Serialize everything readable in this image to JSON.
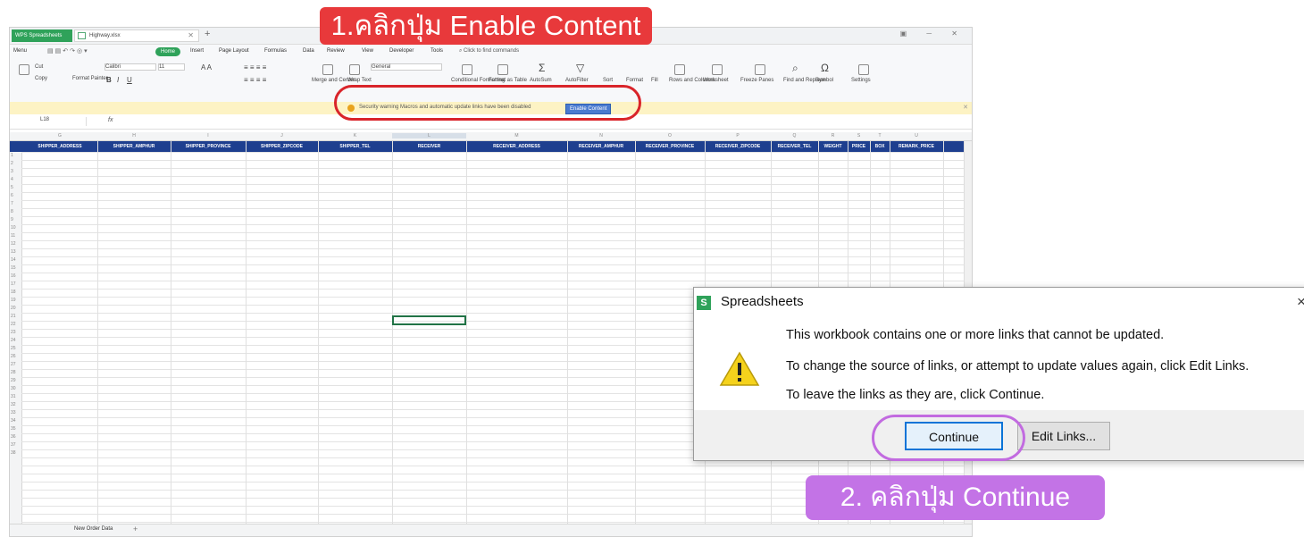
{
  "app": {
    "app_tab": "WPS Spreadsheets",
    "doc_tab": "Highway.xlsx",
    "menu": [
      "Menu",
      "Home",
      "Insert",
      "Page Layout",
      "Formulas",
      "Data",
      "Review",
      "View",
      "Developer",
      "Tools"
    ],
    "search_placeholder": "Click to find commands",
    "font_name": "Calibri",
    "font_size": "11",
    "number_format": "General",
    "ribbon_labels": [
      "Cut",
      "Copy",
      "Format Painter",
      "Merge and Center",
      "Wrap Text",
      "Conditional Formatting",
      "Format as Table",
      "AutoSum",
      "AutoFilter",
      "Sort",
      "Format",
      "Fill",
      "Rows and Columns",
      "Worksheet",
      "Freeze Panes",
      "Find and Replace",
      "Symbol",
      "Settings"
    ]
  },
  "security_bar": {
    "text": "Security warning Macros and automatic update links have been disabled",
    "button": "Enable Content"
  },
  "formula_bar": {
    "cell_ref": "L18",
    "fx": "fx"
  },
  "grid": {
    "header_cells": [
      "SHIPPER_ADDRESS",
      "SHIPPER_AMPHUR",
      "SHIPPER_PROVINCE",
      "SHIPPER_ZIPCODE",
      "SHIPPER_TEL",
      "RECEIVER",
      "RECEIVER_ADDRESS",
      "RECEIVER_AMPHUR",
      "RECEIVER_PROVINCE",
      "RECEIVER_ZIPCODE",
      "RECEIVER_TEL",
      "WEIGHT",
      "PRICE",
      "BOX",
      "REMARK_PRICE"
    ],
    "column_letters": [
      "G",
      "H",
      "I",
      "J",
      "K",
      "L",
      "M",
      "N",
      "O",
      "P",
      "Q",
      "R",
      "S",
      "T",
      "U"
    ],
    "row_numbers": [
      "1",
      "2",
      "3",
      "4",
      "5",
      "6",
      "7",
      "8",
      "9",
      "10",
      "11",
      "12",
      "13",
      "14",
      "15",
      "16",
      "17",
      "18",
      "19",
      "20",
      "21",
      "22",
      "23",
      "24",
      "25",
      "26",
      "27",
      "28",
      "29",
      "30",
      "31",
      "32",
      "33",
      "34",
      "35",
      "36",
      "37",
      "38"
    ],
    "sheet_tab": "New Order Data"
  },
  "annotations": {
    "step1": "1.คลิกปุ่ม Enable Content",
    "step2": "2. คลิกปุ่ม Continue"
  },
  "dialog": {
    "title": "Spreadsheets",
    "close": "×",
    "line1": "This workbook contains one or more links that cannot be updated.",
    "line2": "To change the source of links, or attempt to update values again, click Edit Links.",
    "line3": "To leave the links as they are, click Continue.",
    "btn_continue": "Continue",
    "btn_edit_links": "Edit Links..."
  },
  "colors": {
    "accent_green": "#2fa25a",
    "header_blue": "#1e3f8f",
    "step1_red": "#e8393b",
    "step2_purple": "#c373e6"
  }
}
